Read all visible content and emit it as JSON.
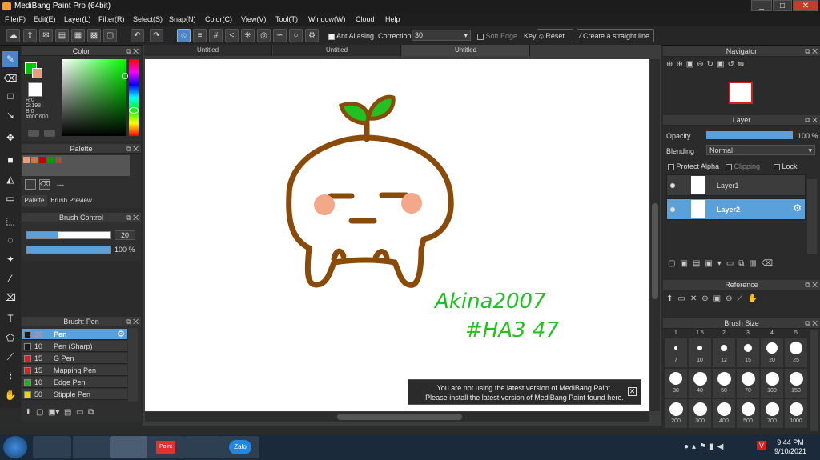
{
  "window": {
    "title": "MediBang Paint Pro (64bit)",
    "btn_min": "_",
    "btn_max": "□",
    "btn_close": "✕"
  },
  "menu": [
    "File(F)",
    "Edit(E)",
    "Layer(L)",
    "Filter(R)",
    "Select(S)",
    "Snap(N)",
    "Color(C)",
    "View(V)",
    "Tool(T)",
    "Window(W)",
    "Cloud",
    "Help"
  ],
  "toolbar": {
    "antialiasing": "AntiAliasing",
    "correction_label": "Correction",
    "correction_value": "30",
    "soft_edge": "Soft Edge",
    "key": "Key",
    "reset": "Reset",
    "straight_line": "Create a straight line"
  },
  "tabs": [
    "Untitled",
    "Untitled",
    "Untitled"
  ],
  "color_panel": {
    "title": "Color",
    "r": "R:0",
    "g": "G:198",
    "b": "B:0",
    "hex": "#00C600"
  },
  "palette_panel": {
    "title": "Palette",
    "tab1": "Palette",
    "tab2": "Brush Preview",
    "name": "---",
    "swatches": [
      "#e8a07a",
      "#c87850",
      "#c80000",
      "#00a000",
      "#8b5a3c"
    ]
  },
  "brush_control": {
    "title": "Brush Control",
    "size": "20",
    "opacity": "100 %",
    "size_fraction": 0.38,
    "opacity_fraction": 1.0
  },
  "brush_list": {
    "title": "Brush: Pen",
    "items": [
      {
        "size": "20",
        "name": "Pen",
        "color": "#1a1a1a"
      },
      {
        "size": "10",
        "name": "Pen (Sharp)",
        "color": "#1a1a1a"
      },
      {
        "size": "15",
        "name": "G Pen",
        "color": "#e02020"
      },
      {
        "size": "15",
        "name": "Mapping Pen",
        "color": "#e02020"
      },
      {
        "size": "10",
        "name": "Edge Pen",
        "color": "#20b020"
      },
      {
        "size": "50",
        "name": "Stipple Pen",
        "color": "#e8d020"
      }
    ]
  },
  "canvas": {
    "signature_line1": "Akina2007",
    "signature_line2": "#HA3 47"
  },
  "notice": {
    "line1": "You are not using the latest version of MediBang Paint.",
    "line2": "Please install the latest version of MediBang Paint found here."
  },
  "navigator": {
    "title": "Navigator"
  },
  "layer_panel": {
    "title": "Layer",
    "opacity_label": "Opacity",
    "opacity_value": "100 %",
    "blending_label": "Blending",
    "blending_value": "Normal",
    "protect_alpha": "Protect Alpha",
    "clipping": "Clipping",
    "lock": "Lock",
    "layers": [
      "Layer1",
      "Layer2"
    ]
  },
  "reference": {
    "title": "Reference"
  },
  "brush_size": {
    "title": "Brush Size",
    "top_labels": [
      "1",
      "1.5",
      "2",
      "3",
      "4",
      "5"
    ],
    "rows": [
      [
        "7",
        "10",
        "12",
        "15",
        "20",
        "25"
      ],
      [
        "30",
        "40",
        "50",
        "70",
        "100",
        "150"
      ],
      [
        "200",
        "300",
        "400",
        "500",
        "700",
        "1000"
      ]
    ]
  },
  "taskbar": {
    "time": "9:44 PM",
    "date": "9/10/2021",
    "zalo": "Zalo",
    "pont": "Point"
  }
}
